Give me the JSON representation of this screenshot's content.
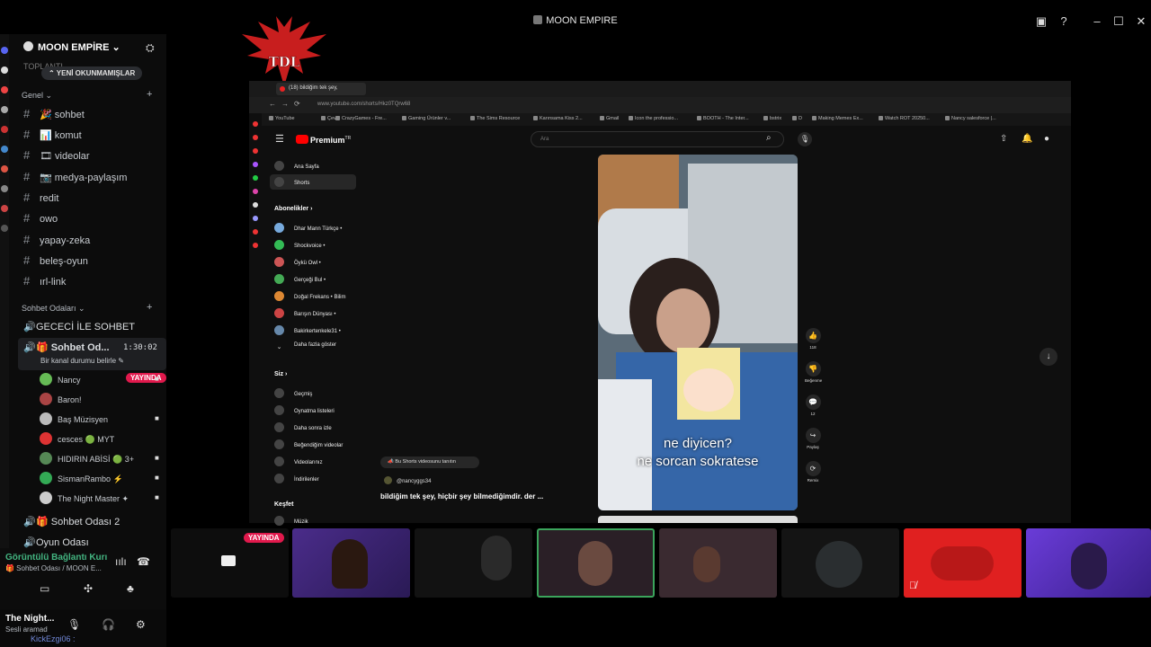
{
  "window": {
    "title": "MOON EMPIRE",
    "minimize": "–",
    "maximize": "☐",
    "close": "✕",
    "help": "?"
  },
  "server": {
    "name": "MOON EMPİRE",
    "chevron": "⌄",
    "add_people": "⛭",
    "blurred_item": "TOPLANTI",
    "new_unreads": "YENİ OKUNMAMIŞLAR",
    "new_unreads_arrow": "⌃"
  },
  "categories": [
    {
      "label": "Genel ⌄",
      "plus": "+"
    },
    {
      "label": "Sohbet Odaları ⌄",
      "plus": "+"
    }
  ],
  "channels": [
    {
      "label": "🎉 sohbet"
    },
    {
      "label": "📊 komut"
    },
    {
      "label": "🎞 videolar"
    },
    {
      "label": "📷 medya-paylaşım"
    },
    {
      "label": "redit"
    },
    {
      "label": "owo"
    },
    {
      "label": "yapay-zeka"
    },
    {
      "label": "beleş-oyun"
    },
    {
      "label": "ırl-link"
    }
  ],
  "voice_channels": {
    "first": "GECECİ İLE SOHBET",
    "active": "🎁 Sohbet Od...",
    "active_timer": "1:30:02",
    "active_status": "Bir kanal durumu belirle ✎",
    "second": "🎁 Sohbet Odası 2",
    "third": "Oyun Odası"
  },
  "voice_users": [
    {
      "name": "Nancy"
    },
    {
      "name": "Baron!"
    },
    {
      "name": "Baş Müzisyen"
    },
    {
      "name": "cesces 🟢 MYT"
    },
    {
      "name": "HIDIRIN ABİSİ 🟢 3+"
    },
    {
      "name": "SismanRambo ⚡"
    },
    {
      "name": "The Night Master ✦"
    }
  ],
  "live_badge": "YAYINDA",
  "voice_status": {
    "title": "Görüntülü Bağlantı Kurı",
    "subtitle": "🎁 Sohbet Odası / MOON E..."
  },
  "user_panel": {
    "name": "The Night...",
    "status": "Sesli aramad",
    "kick": "KickEzgi06 :"
  },
  "browser": {
    "tab_title": "(18) bildiğim tek şey,",
    "url": "www.youtube.com/shorts/Hkz0TQrw68",
    "bookmarks": [
      "YouTube",
      "Çeviri",
      "CrazyGames - Fre...",
      "Gaming Ürünler v...",
      "The Sims Resource",
      "Karınsama Kiss 2...",
      "Gmail",
      "Icon the professio...",
      "BOOTH - The Inter...",
      "bstrix",
      "D",
      "Making Memes Ex...",
      "Watch ROT 20250...",
      "Nancy salesforce |..."
    ]
  },
  "youtube": {
    "logo": "Premium",
    "logo_sup": "TR",
    "search_placeholder": "Ara",
    "nav": [
      {
        "label": "Ana Sayfa"
      },
      {
        "label": "Shorts"
      }
    ],
    "subs_header": "Abonelikler ›",
    "subs": [
      {
        "label": "Dhar Mann Türkçe •"
      },
      {
        "label": "Shockvoice •"
      },
      {
        "label": "Öykü Owl •"
      },
      {
        "label": "Gerçeği Bul •"
      },
      {
        "label": "Doğal Frekans • Bilim"
      },
      {
        "label": "Barışın Dünyası •"
      },
      {
        "label": "Bakirkertenkele31 •"
      },
      {
        "label": "Daha fazla göster"
      }
    ],
    "you_header": "Siz ›",
    "you": [
      {
        "label": "Geçmiş"
      },
      {
        "label": "Oynatma listeleri"
      },
      {
        "label": "Daha sonra izle"
      },
      {
        "label": "Beğendiğim videolar"
      },
      {
        "label": "Videolarınız"
      },
      {
        "label": "İndirilenler"
      }
    ],
    "explore_header": "Keşfet",
    "explore": [
      {
        "label": "Müzik"
      }
    ],
    "short": {
      "caption_line1": "ne diyicen?",
      "caption_line2": "ne sorcan sokratese",
      "promo": "Bu Shorts videosunu tanıtın",
      "channel": "@nancyggs34",
      "description": "bildiğim tek şey, hiçbir şey bilmediğimdir. der ...",
      "actions": [
        {
          "icon": "👍",
          "label": "118"
        },
        {
          "icon": "👎",
          "label": "Beğenme"
        },
        {
          "icon": "💬",
          "label": "12"
        },
        {
          "icon": "↪",
          "label": "Paylaş"
        },
        {
          "icon": "⟳",
          "label": "Remix"
        }
      ]
    }
  }
}
